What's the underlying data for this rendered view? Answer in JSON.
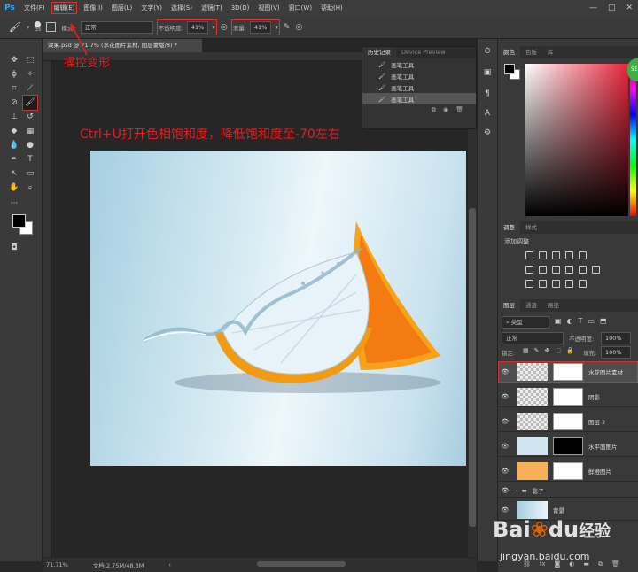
{
  "app": {
    "logo": "Ps"
  },
  "menubar": {
    "items": [
      "文件(F)",
      "编辑(E)",
      "图像(I)",
      "图层(L)",
      "文字(Y)",
      "选择(S)",
      "滤镜(T)",
      "3D(D)",
      "视图(V)",
      "窗口(W)",
      "帮助(H)"
    ],
    "window_controls": [
      "—",
      "□",
      "✕"
    ]
  },
  "options": {
    "brush_size": "35",
    "mode_label": "模式:",
    "mode_value": "正常",
    "opacity_label": "不透明度:",
    "opacity_value": "41%",
    "flow_label": "流量:",
    "flow_value": "41%"
  },
  "document": {
    "tab_title": "效果.psd @ 71.7% (水花图片素材, 图层蒙版/8) *",
    "zoom": "71.71%",
    "doc_size": "文档:2.75M/48.3M"
  },
  "annotations": {
    "first": "操控变形",
    "second": "Ctrl+U打开色相饱和度，降低饱和度至-70左右"
  },
  "history": {
    "tabs": [
      "历史记录",
      "Device Preview"
    ],
    "items": [
      "画笔工具",
      "画笔工具",
      "画笔工具",
      "画笔工具"
    ]
  },
  "color_panel": {
    "tabs": [
      "颜色",
      "色板",
      "库"
    ],
    "foreground": "#000000",
    "background": "#ffffff",
    "badge": "51"
  },
  "adjustments": {
    "tabs": [
      "调整",
      "样式"
    ],
    "title": "添加调整"
  },
  "layers": {
    "tabs": [
      "图层",
      "通道",
      "路径"
    ],
    "filter": "类型",
    "blend": "正常",
    "opacity_label": "不透明度:",
    "opacity_value": "100%",
    "lock_label": "锁定:",
    "fill_label": "填充:",
    "fill_value": "100%",
    "rows": [
      {
        "name": "水花图片素材"
      },
      {
        "name": "阴影"
      },
      {
        "name": "图层 2"
      },
      {
        "name": "水平面图片"
      },
      {
        "name": "鲜橙图片"
      },
      {
        "name": "影子"
      },
      {
        "name": "背景"
      }
    ]
  },
  "watermark": {
    "brand": "Bai",
    "brand2": "du",
    "cn": "经验",
    "url": "jingyan.baidu.com"
  },
  "colors": {
    "accent": "#e02020",
    "ps_blue": "#31a8ff"
  }
}
